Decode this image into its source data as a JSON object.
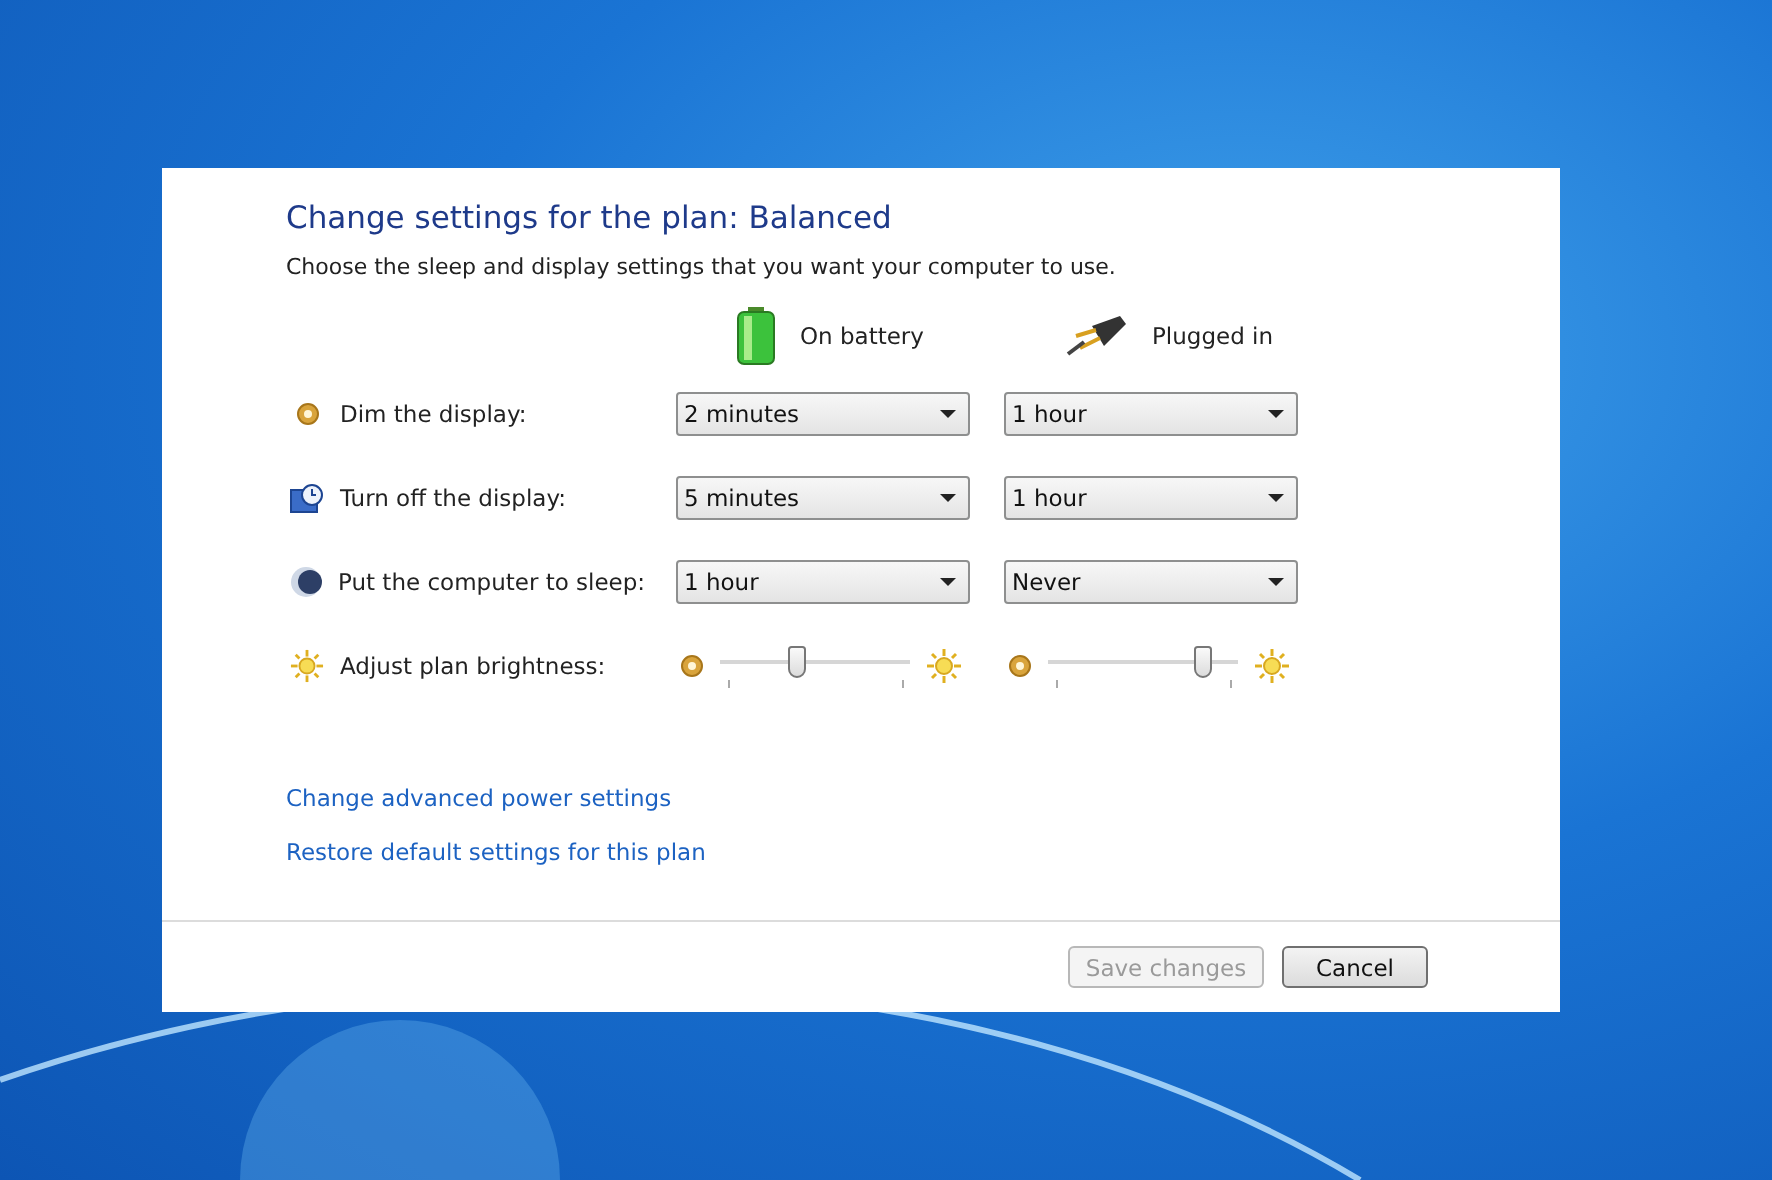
{
  "panel": {
    "title": "Change settings for the plan: Balanced",
    "subtitle": "Choose the sleep and display settings that you want your computer to use.",
    "columns": [
      {
        "label": "On battery",
        "kind": "battery"
      },
      {
        "label": "Plugged in",
        "kind": "plug"
      }
    ],
    "rows": [
      {
        "label": "Dim the display:",
        "kind": "dropdown",
        "values": [
          "2 minutes",
          "1 hour"
        ]
      },
      {
        "label": "Turn off the display:",
        "kind": "dropdown",
        "values": [
          "5 minutes",
          "1 hour"
        ]
      },
      {
        "label": "Put the computer to sleep:",
        "kind": "dropdown",
        "values": [
          "1 hour",
          "Never"
        ]
      },
      {
        "label": "Adjust plan brightness:",
        "kind": "slider",
        "levels": [
          {
            "level": 0.41
          },
          {
            "level": 0.82
          }
        ]
      }
    ],
    "links": [
      "Change advanced power settings",
      "Restore default settings for this plan"
    ],
    "buttons": [
      {
        "label": "Save changes",
        "disabled": true
      },
      {
        "label": "Cancel",
        "disabled": false
      }
    ]
  }
}
